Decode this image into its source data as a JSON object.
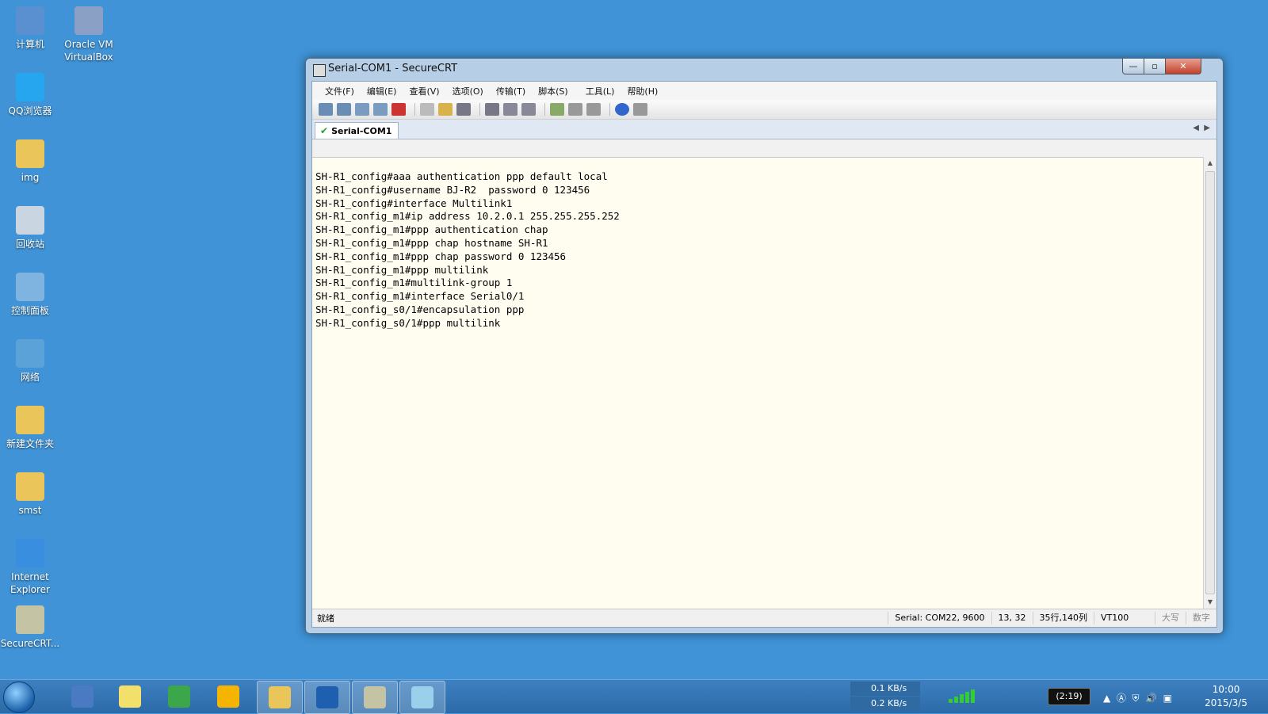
{
  "desktop": {
    "icons": [
      {
        "label": "计算机",
        "icon": "computer-icon",
        "color": "#5a8fd0"
      },
      {
        "label": "Oracle VM VirtualBox",
        "icon": "virtualbox-icon",
        "color": "#8aa0c4"
      },
      {
        "label": "QQ浏览器",
        "icon": "qq-browser-icon",
        "color": "#27a6f0"
      },
      {
        "label": "img",
        "icon": "folder-icon",
        "color": "#e9c55a"
      },
      {
        "label": "回收站",
        "icon": "recycle-bin-icon",
        "color": "#c9d6e2"
      },
      {
        "label": "控制面板",
        "icon": "control-panel-icon",
        "color": "#7fb3e0"
      },
      {
        "label": "网络",
        "icon": "network-icon",
        "color": "#5aa2d8"
      },
      {
        "label": "新建文件夹",
        "icon": "folder-icon",
        "color": "#e9c55a"
      },
      {
        "label": "smst",
        "icon": "folder-shortcut-icon",
        "color": "#e9c55a"
      },
      {
        "label": "Internet Explorer",
        "icon": "ie-icon",
        "color": "#3a8ee0"
      },
      {
        "label": "SecureCRT...",
        "icon": "securecrt-icon",
        "color": "#c4c4a4"
      }
    ]
  },
  "window": {
    "title": "Serial-COM1 - SecureCRT",
    "controls": {
      "minimize": "—",
      "maximize": "▫",
      "close": "✕"
    },
    "menu": [
      "文件(F)",
      "编辑(E)",
      "查看(V)",
      "选项(O)",
      "传输(T)",
      "脚本(S)",
      "工具(L)",
      "帮助(H)"
    ],
    "toolbar_icons": [
      "connect-icon",
      "quick-connect-icon",
      "connect-tab-icon",
      "reconnect-icon",
      "disconnect-icon",
      "copy-icon",
      "paste-icon",
      "find-icon",
      "print-icon",
      "print-setup-icon",
      "print-screen-icon",
      "session-options-icon",
      "global-options-icon",
      "keymap-icon",
      "help-icon",
      "sftp-icon"
    ],
    "tab": {
      "label": "Serial-COM1"
    },
    "terminal_lines": [
      "SH-R1_config#aaa authentication ppp default local",
      "SH-R1_config#username BJ-R2  password 0 123456",
      "SH-R1_config#interface Multilink1",
      "SH-R1_config_m1#ip address 10.2.0.1 255.255.255.252",
      "SH-R1_config_m1#ppp authentication chap",
      "SH-R1_config_m1#ppp chap hostname SH-R1",
      "SH-R1_config_m1#ppp chap password 0 123456",
      "SH-R1_config_m1#ppp multilink",
      "SH-R1_config_m1#multilink-group 1",
      "SH-R1_config_m1#interface Serial0/1",
      "SH-R1_config_s0/1#encapsulation ppp",
      "SH-R1_config_s0/1#ppp multilink"
    ],
    "status": {
      "ready": "就绪",
      "serial": "Serial: COM22, 9600",
      "cursor": "13,  32",
      "size": "35行,140列",
      "emulation": "VT100",
      "caps": "大写",
      "num": "数字"
    }
  },
  "taskbar": {
    "apps": [
      {
        "name": "remote-desktop-icon",
        "color": "#4a7bc2",
        "active": false
      },
      {
        "name": "sticky-notes-icon",
        "color": "#f2e06a",
        "active": false
      },
      {
        "name": "chrome-icon",
        "color": "#3ca64a",
        "active": false
      },
      {
        "name": "qq-browser-icon",
        "color": "#f5b400",
        "active": false
      },
      {
        "name": "explorer-icon",
        "color": "#e9c55a",
        "active": true
      },
      {
        "name": "word-icon",
        "color": "#1f5fb0",
        "active": true
      },
      {
        "name": "securecrt-icon",
        "color": "#c4c4a4",
        "active": true
      },
      {
        "name": "notepad-icon",
        "color": "#9ad0ea",
        "active": true
      }
    ],
    "net_down": "0.1 KB/s",
    "net_up": "0.2 KB/s",
    "battery": "(2:19)",
    "time": "10:00",
    "date": "2015/3/5"
  }
}
